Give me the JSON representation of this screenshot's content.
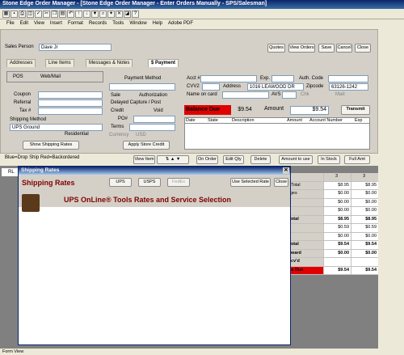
{
  "window": {
    "title": "Stone Edge Order Manager - [Stone Edge Order Manager - Enter Orders Manually - SPS/Salesman]"
  },
  "menu": [
    "File",
    "Edit",
    "View",
    "Insert",
    "Format",
    "Records",
    "Tools",
    "Window",
    "Help",
    "Adobe PDF"
  ],
  "sales_person": {
    "label": "Sales Person",
    "value": "Dave Jr"
  },
  "top_buttons": [
    "Quotes",
    "View Orders",
    "Save",
    "Cancel",
    "Close"
  ],
  "tabs": [
    "Addresses",
    "Line Items",
    "Messages & Notes",
    "$ Payment"
  ],
  "pos": {
    "label": "POS",
    "web_mail": "Web/Mail"
  },
  "left_fields": {
    "coupon": "Coupon",
    "referral": "Referral",
    "tax": "Tax #",
    "shipping_method_label": "Shipping Method",
    "shipping_method": "UPS Ground",
    "residential": "Residential",
    "show_rates": "Show Shipping Rates"
  },
  "payment": {
    "label": "Payment Method",
    "sale": "Sale",
    "authorization": "Authorization",
    "delayed": "Delayed Capture / Post",
    "credit": "Credit",
    "void": "Void",
    "po": "PO#",
    "terms": "Terms",
    "currency": "Currency",
    "currency_code": "USD",
    "apply_credit": "Apply Store Credit"
  },
  "card": {
    "acct": "Acct #",
    "exp": "Exp.",
    "auth_code": "Auth. Code",
    "cvv2": "CVV2",
    "address_label": "Address",
    "address": "1016 LEAWOOD DR",
    "zip_label": "Zipcode",
    "zip": "63126-1242",
    "name_on_card": "Name on card",
    "avs": "AVS",
    "chk": "Chk",
    "avs2": "Mail:"
  },
  "balance": {
    "label": "Balance Due",
    "value": "$9.54",
    "amount_label": "Amount",
    "amount": "$9.54",
    "transmit": "Transmit"
  },
  "txn_columns": [
    "Date",
    "State",
    "Description",
    "Amount",
    "Account Number",
    "Exp"
  ],
  "lower_bar": {
    "left_text": "Blue=Drop Ship  Red=Backordered",
    "view_item": "View Item",
    "on_order": "On Order",
    "edit_qty": "Edit Qty",
    "delete": "Delete",
    "amount_to_use": "Amount to use",
    "in_stock": "In Stock",
    "full_amt": "Full Amt"
  },
  "grid_left": "RL",
  "totals_header": [
    "",
    "3",
    "3"
  ],
  "totals": [
    {
      "label": "t Total",
      "a": "$8.95",
      "b": "$8.95",
      "bold": false
    },
    {
      "label": "rges",
      "a": "$0.00",
      "b": "$0.00",
      "bold": false
    },
    {
      "label": "",
      "a": "$0.00",
      "b": "$0.00",
      "bold": false
    },
    {
      "label": "t",
      "a": "$0.00",
      "b": "$0.00",
      "bold": false
    },
    {
      "label": "Total",
      "a": "$8.95",
      "b": "$8.95",
      "bold": true
    },
    {
      "label": "e",
      "a": "$0.59",
      "b": "$0.59",
      "bold": false
    },
    {
      "label": "g",
      "a": "$0.00",
      "b": "$0.00",
      "bold": false
    },
    {
      "label": "Total",
      "a": "$9.54",
      "b": "$9.54",
      "bold": true
    },
    {
      "label": "eward",
      "a": "$0.00",
      "b": "$0.00",
      "bold": true
    },
    {
      "label": "ecv'd",
      "a": "",
      "b": "",
      "bold": true
    },
    {
      "label": "ue Due",
      "a": "$9.54",
      "b": "$9.54",
      "bold": true
    }
  ],
  "dialog": {
    "title": "Shipping Rates",
    "heading": "Shipping Rates",
    "buttons": [
      "UPS",
      "USPS",
      "FedEx"
    ],
    "use_selected": "Use Selected Rate",
    "close": "Close",
    "ups_title": "UPS OnLine® Tools Rates and Service Selection"
  },
  "status": "Form View"
}
